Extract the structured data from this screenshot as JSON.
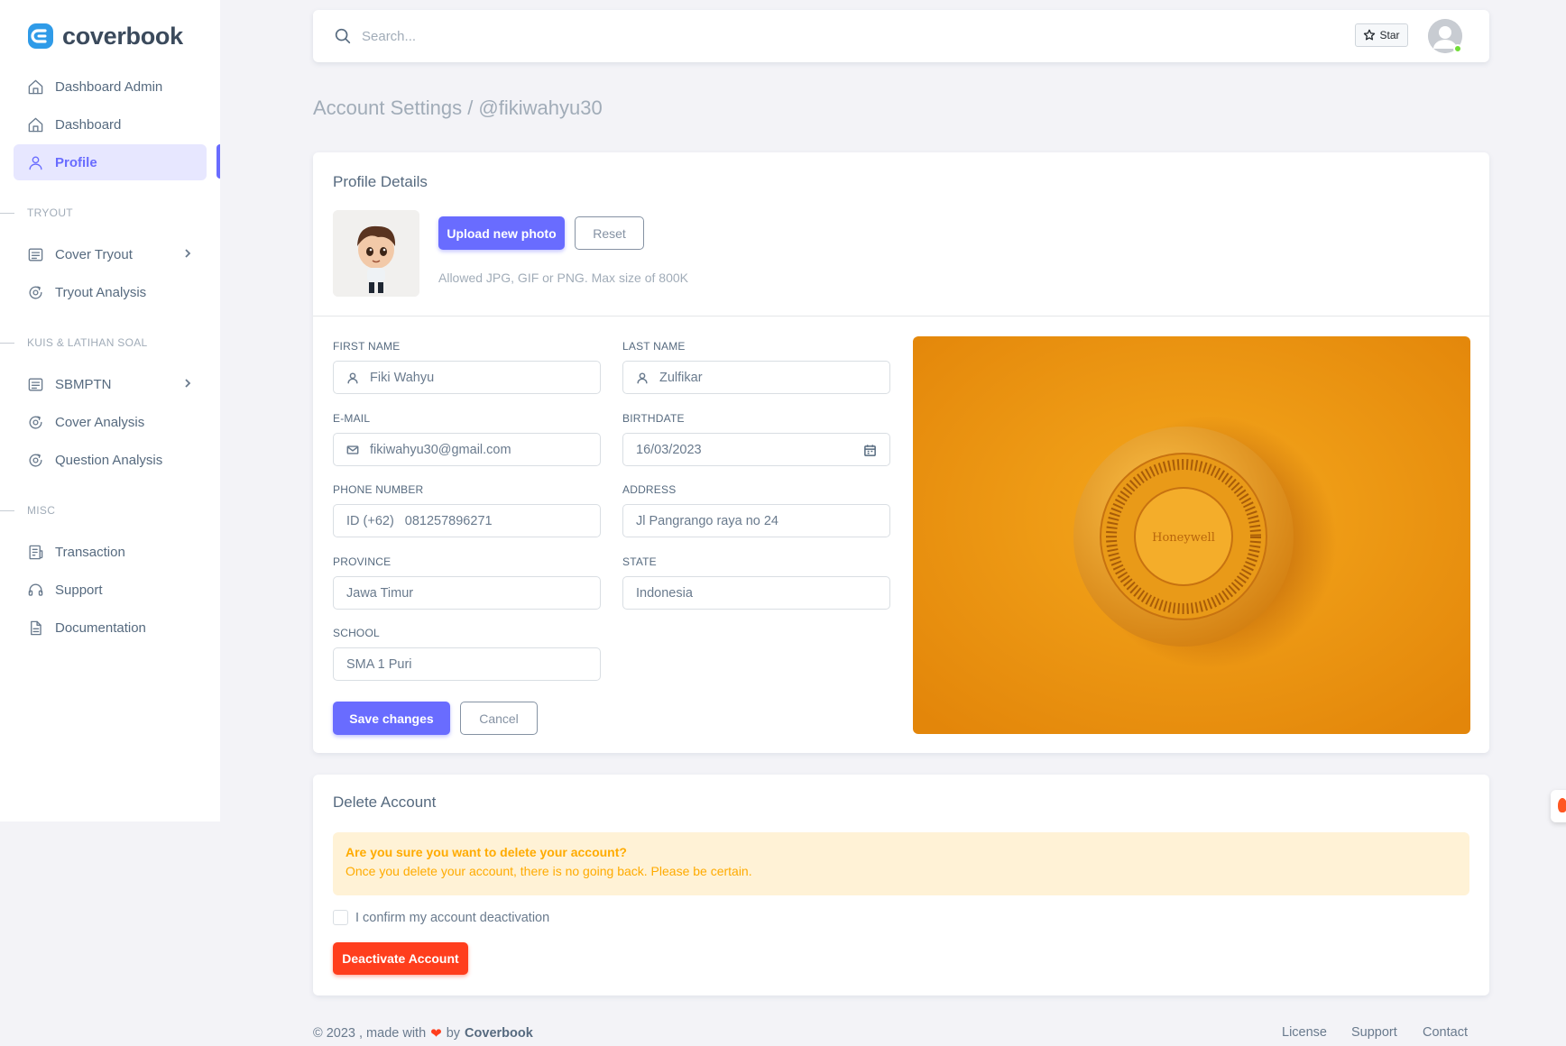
{
  "brand": {
    "name": "coverbook",
    "color": "#696cff"
  },
  "sidebar": {
    "items": [
      {
        "label": "Dashboard Admin",
        "icon": "home-icon"
      },
      {
        "label": "Dashboard",
        "icon": "home-icon"
      },
      {
        "label": "Profile",
        "icon": "user-icon",
        "active": true
      },
      {
        "label": "Cover Tryout",
        "icon": "list-icon",
        "has_submenu": true
      },
      {
        "label": "Tryout Analysis",
        "icon": "analysis-icon"
      },
      {
        "label": "SBMPTN",
        "icon": "list-icon",
        "has_submenu": true
      },
      {
        "label": "Cover Analysis",
        "icon": "analysis-icon"
      },
      {
        "label": "Question Analysis",
        "icon": "analysis-icon"
      },
      {
        "label": "Transaction",
        "icon": "receipt-icon"
      },
      {
        "label": "Support",
        "icon": "headset-icon"
      },
      {
        "label": "Documentation",
        "icon": "document-icon"
      }
    ],
    "headers": [
      "TRYOUT",
      "KUIS & LATIHAN SOAL",
      "MISC"
    ]
  },
  "navbar": {
    "search_placeholder": "Search...",
    "star_label": "Star"
  },
  "breadcrumb": "Account Settings / @fikiwahyu30",
  "profile": {
    "title": "Profile Details",
    "upload_label": "Upload new photo",
    "reset_label": "Reset",
    "hint": "Allowed JPG, GIF or PNG. Max size of 800K",
    "fields": {
      "first_name": {
        "label": "FIRST NAME",
        "value": "Fiki Wahyu"
      },
      "last_name": {
        "label": "LAST NAME",
        "value": "Zulfikar"
      },
      "email": {
        "label": "E-MAIL",
        "value": "fikiwahyu30@gmail.com"
      },
      "birthdate": {
        "label": "BIRTHDATE",
        "value": "16/03/2023"
      },
      "phone": {
        "label": "PHONE NUMBER",
        "prefix": "ID (+62)",
        "value": "081257896271"
      },
      "address": {
        "label": "ADDRESS",
        "value": "Jl Pangrango raya no 24"
      },
      "province": {
        "label": "PROVINCE",
        "value": "Jawa Timur"
      },
      "state": {
        "label": "STATE",
        "value": "Indonesia"
      },
      "school": {
        "label": "SCHOOL",
        "value": "SMA 1 Puri"
      }
    },
    "save_label": "Save changes",
    "cancel_label": "Cancel",
    "image_text": "Honeywell"
  },
  "delete": {
    "title": "Delete Account",
    "alert_title": "Are you sure you want to delete your account?",
    "alert_body": "Once you delete your account, there is no going back. Please be certain.",
    "confirm_label": "I confirm my account deactivation",
    "button_label": "Deactivate Account"
  },
  "footer": {
    "copyright": "© 2023 , made with",
    "by": "by",
    "brand": "Coverbook",
    "links": [
      "License",
      "Support",
      "Contact"
    ]
  }
}
